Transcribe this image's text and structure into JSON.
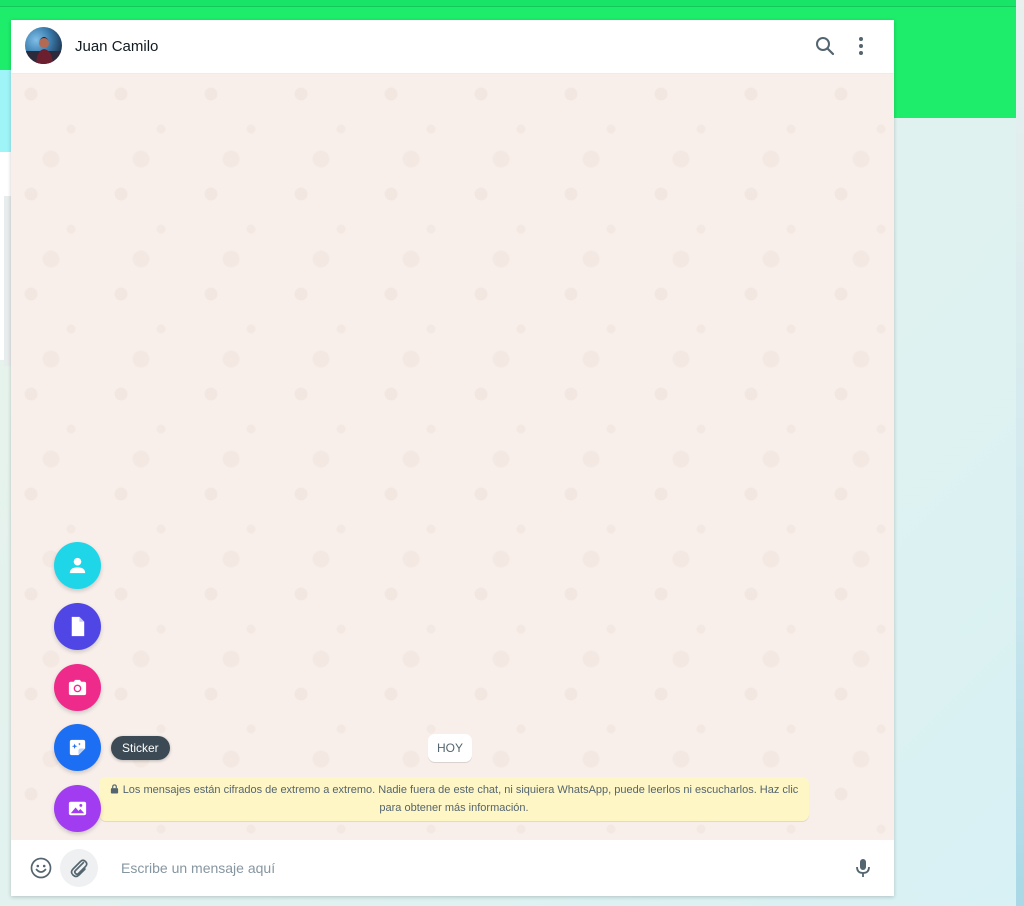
{
  "chat": {
    "contact_name": "Juan Camilo"
  },
  "messages": {
    "day_label": "HOY",
    "encryption_notice": "Los mensajes están cifrados de extremo a extremo. Nadie fuera de este chat, ni siquiera WhatsApp, puede leerlos ni escucharlos. Haz clic para obtener más información."
  },
  "attach_menu": {
    "items": [
      {
        "icon": "contact-icon",
        "color": "#1fd5e8"
      },
      {
        "icon": "document-icon",
        "color": "#4f46e5"
      },
      {
        "icon": "camera-icon",
        "color": "#ee2a8a"
      },
      {
        "icon": "sticker-icon",
        "color": "#1c6ef2"
      },
      {
        "icon": "photo-icon",
        "color": "#a13cf0"
      }
    ],
    "tooltip": "Sticker"
  },
  "composer": {
    "placeholder": "Escribe un mensaje aquí"
  },
  "colors": {
    "brand_green": "#1ded6b",
    "notice_bg": "#fff6c5",
    "chat_bg": "#f8efeb"
  }
}
